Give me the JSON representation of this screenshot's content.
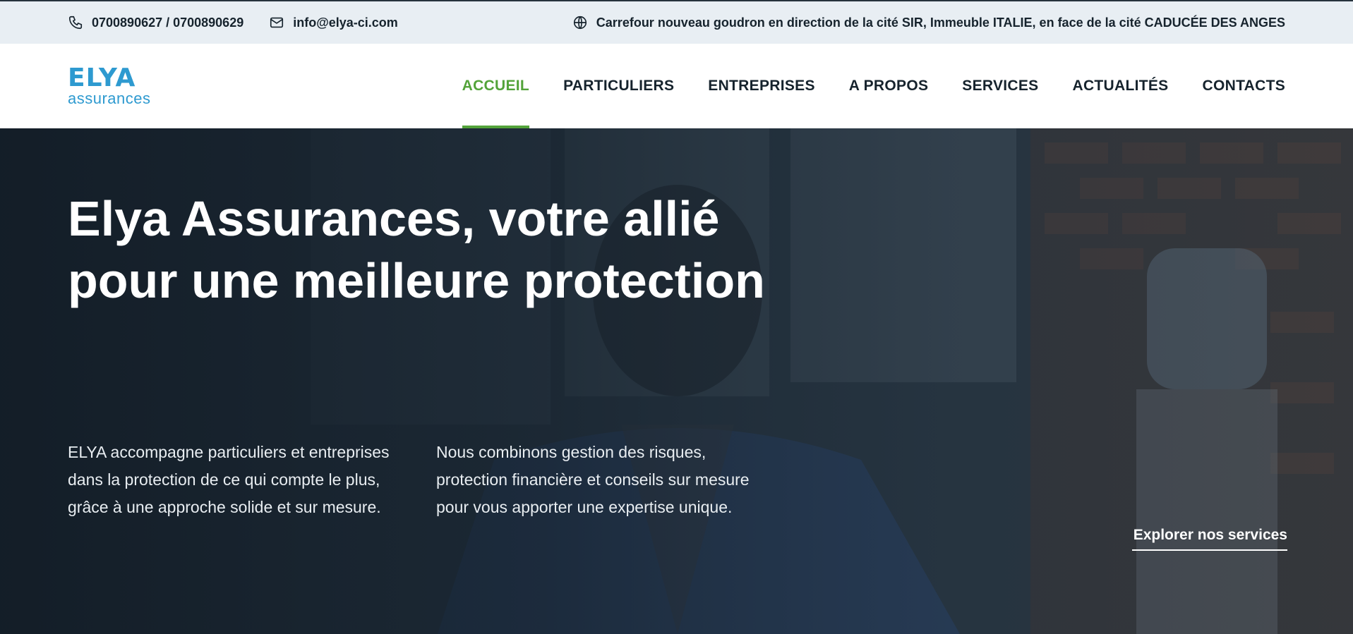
{
  "topbar": {
    "phone": "0700890627 / 0700890629",
    "email": "info@elya-ci.com",
    "address": "Carrefour nouveau goudron en direction de la cité SIR, Immeuble ITALIE, en face de la cité CADUCÉE DES ANGES",
    "icons": {
      "phone": "phone-icon",
      "email": "mail-icon",
      "address": "globe-icon"
    }
  },
  "header": {
    "logo_mark": "ELYA",
    "logo_sub": "assurances",
    "nav": [
      {
        "label": "ACCUEIL",
        "active": true
      },
      {
        "label": "PARTICULIERS",
        "active": false
      },
      {
        "label": "ENTREPRISES",
        "active": false
      },
      {
        "label": "A PROPOS",
        "active": false
      },
      {
        "label": "SERVICES",
        "active": false
      },
      {
        "label": "ACTUALITÉS",
        "active": false
      },
      {
        "label": "CONTACTS",
        "active": false
      }
    ]
  },
  "hero": {
    "title": "Elya Assurances, votre allié pour une meilleure protection",
    "paragraph_1": "ELYA accompagne particuliers et entreprises dans la protection de ce qui compte le plus, grâce à une approche solide et sur mesure.",
    "paragraph_2": "Nous combinons gestion des risques, protection financière et conseils sur mesure pour vous apporter une expertise unique.",
    "cta": "Explorer nos services"
  },
  "colors": {
    "accent_green": "#53a33a",
    "brand_blue": "#2e9ad0",
    "dark_text": "#16232d",
    "topbar_bg": "#e8eef3"
  }
}
